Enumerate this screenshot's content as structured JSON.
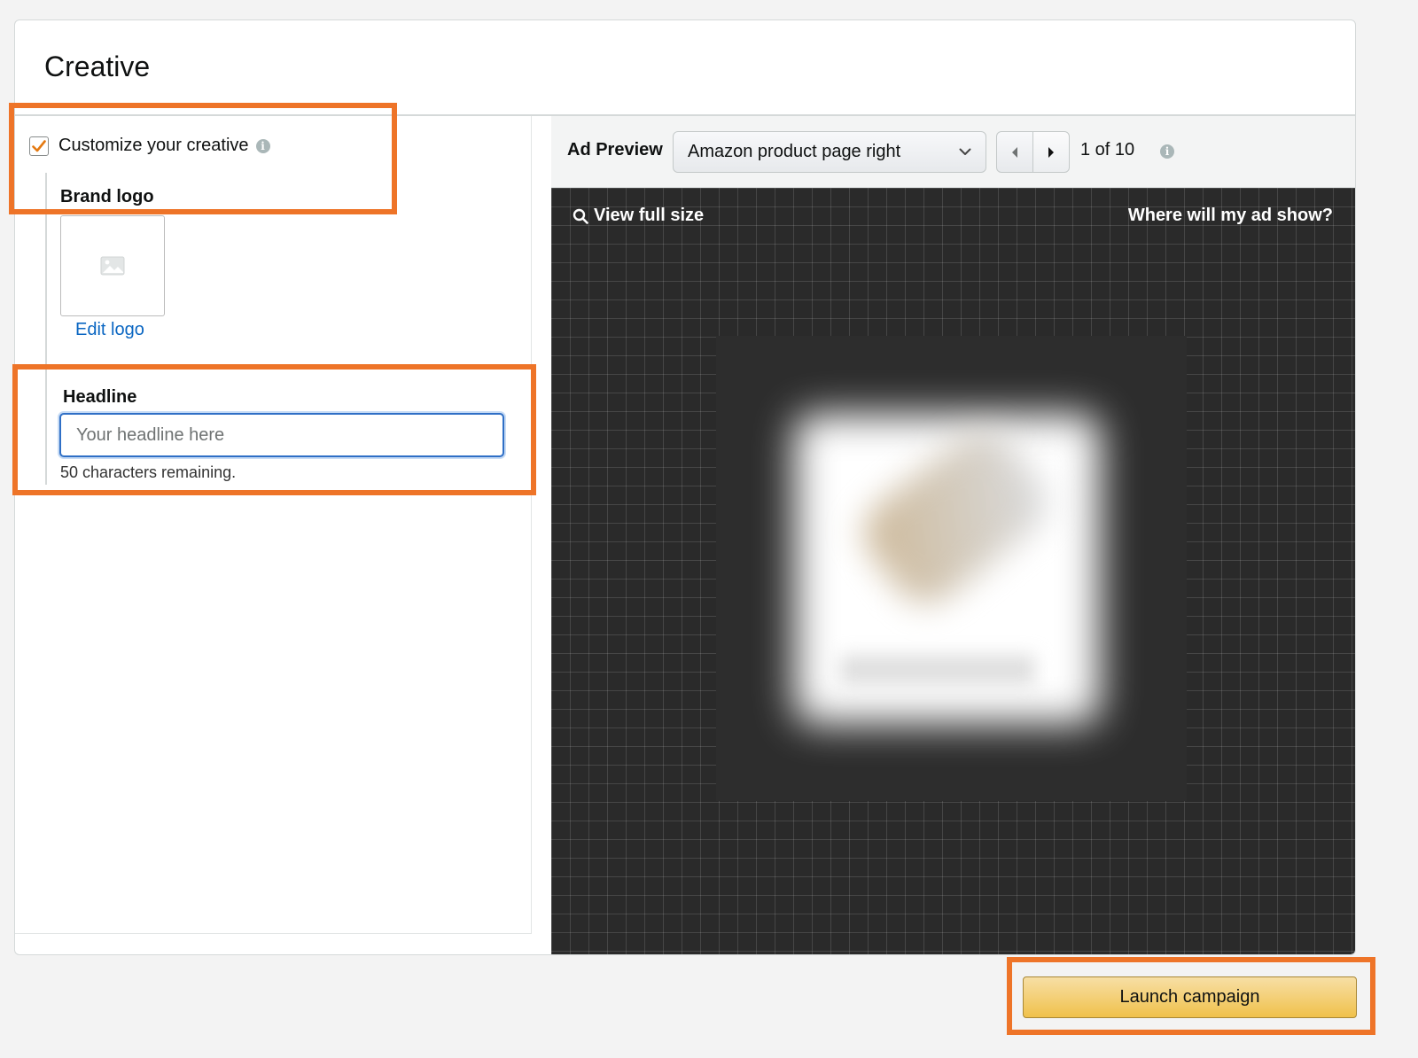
{
  "card": {
    "title": "Creative"
  },
  "customize": {
    "checked": true,
    "label": "Customize your creative",
    "info_icon": "info-icon"
  },
  "brand_logo": {
    "label": "Brand logo",
    "placeholder_icon": "image-placeholder-icon",
    "edit_link": "Edit logo"
  },
  "headline": {
    "label": "Headline",
    "value": "",
    "placeholder": "Your headline here",
    "remaining": "50 characters remaining."
  },
  "preview": {
    "label": "Ad Preview",
    "placement": "Amazon product page right",
    "page_count": "1 of 10",
    "view_full_size": "View full size",
    "where_show": "Where will my ad show?"
  },
  "footer": {
    "launch_label": "Launch campaign"
  },
  "colors": {
    "highlight": "#ee7428",
    "link": "#0a66c2",
    "checkbox_mark": "#e47911",
    "launch_button": "#f0c14b",
    "preview_background": "#2a2a2a"
  }
}
